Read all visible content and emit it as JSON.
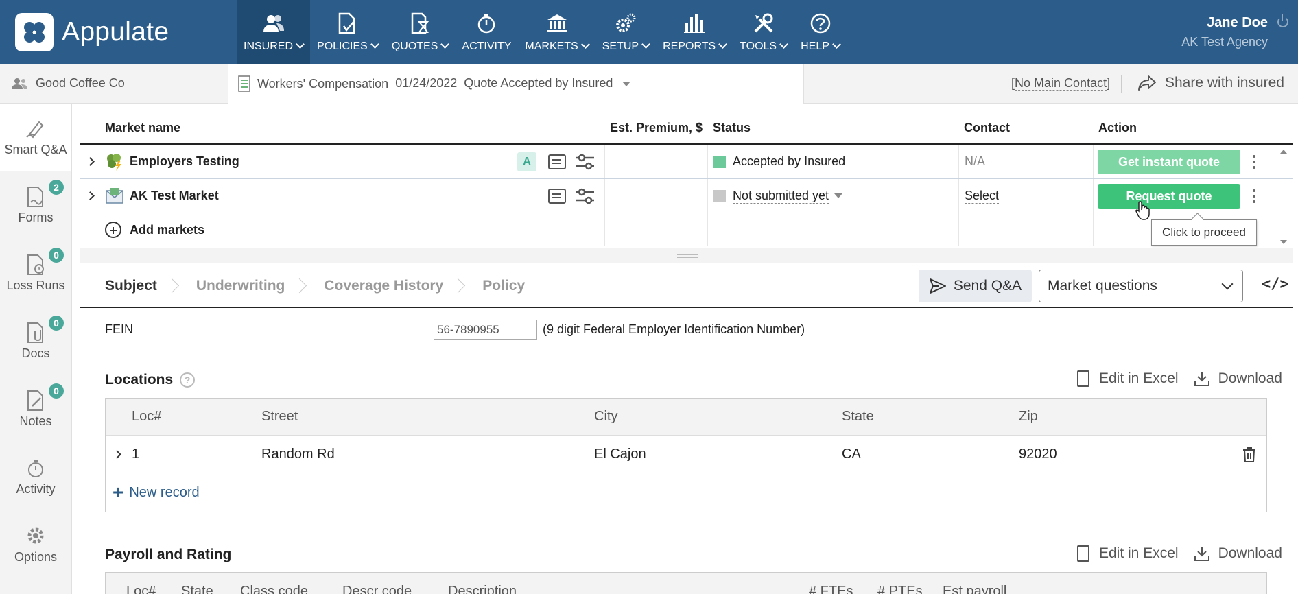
{
  "app": {
    "logo_text": "Appulate"
  },
  "nav": [
    {
      "label": "INSURED",
      "icon": "users-icon",
      "active": true
    },
    {
      "label": "POLICIES",
      "icon": "policy-icon"
    },
    {
      "label": "QUOTES",
      "icon": "quote-hourglass-icon"
    },
    {
      "label": "ACTIVITY",
      "icon": "stopwatch-icon",
      "noarrow": true
    },
    {
      "label": "MARKETS",
      "icon": "bank-icon"
    },
    {
      "label": "SETUP",
      "icon": "gears-icon"
    },
    {
      "label": "REPORTS",
      "icon": "bar-chart-icon"
    },
    {
      "label": "TOOLS",
      "icon": "tools-icon"
    },
    {
      "label": "HELP",
      "icon": "question-icon"
    }
  ],
  "user": {
    "name": "Jane Doe",
    "agency": "AK Test Agency"
  },
  "subbar": {
    "insured_name": "Good Coffee Co",
    "policy_type": "Workers' Compensation",
    "policy_date": "01/24/2022",
    "policy_status": "Quote Accepted by Insured",
    "main_contact": "No Main Contact",
    "share_label": "Share with insured"
  },
  "sidebar": [
    {
      "label": "Smart Q&A",
      "icon": "smart-qa-icon",
      "active": true
    },
    {
      "label": "Forms",
      "icon": "forms-icon",
      "badge": "2"
    },
    {
      "label": "Loss Runs",
      "icon": "loss-runs-icon",
      "badge": "0"
    },
    {
      "label": "Docs",
      "icon": "docs-icon",
      "badge": "0"
    },
    {
      "label": "Notes",
      "icon": "notes-icon",
      "badge": "0"
    },
    {
      "label": "Activity",
      "icon": "activity-icon"
    },
    {
      "label": "Options",
      "icon": "options-gear-icon"
    }
  ],
  "markets_table": {
    "headers": {
      "name": "Market name",
      "premium": "Est. Premium, $",
      "status": "Status",
      "contact": "Contact",
      "action": "Action"
    },
    "rows": [
      {
        "name": "Employers Testing",
        "badge": "A",
        "premium": "",
        "status": "Accepted by Insured",
        "status_color": "#6cc99a",
        "contact": "N/A",
        "action": "Get instant quote"
      },
      {
        "name": "AK Test Market",
        "premium": "",
        "status": "Not submitted yet",
        "status_color": "#c8c8c8",
        "contact": "Select",
        "action": "Request quote"
      }
    ],
    "add_markets": "Add markets",
    "tooltip": "Click to proceed"
  },
  "qa": {
    "tabs": [
      "Subject",
      "Underwriting",
      "Coverage History",
      "Policy"
    ],
    "send_label": "Send Q&A",
    "select_value": "Market questions"
  },
  "form": {
    "fein_label": "FEIN",
    "fein_value": "56-7890955",
    "fein_hint": "(9 digit Federal Employer Identification Number)"
  },
  "locations": {
    "title": "Locations",
    "edit_excel": "Edit in Excel",
    "download": "Download",
    "headers": [
      "Loc#",
      "Street",
      "City",
      "State",
      "Zip"
    ],
    "rows": [
      [
        "1",
        "Random Rd",
        "El Cajon",
        "CA",
        "92020"
      ]
    ],
    "new_record": "New record"
  },
  "payroll": {
    "title": "Payroll and Rating",
    "edit_excel": "Edit in Excel",
    "download": "Download",
    "headers": [
      "Loc#",
      "State",
      "Class code",
      "Descr code",
      "Description",
      "# FTEs",
      "# PTEs",
      "Est payroll"
    ]
  }
}
